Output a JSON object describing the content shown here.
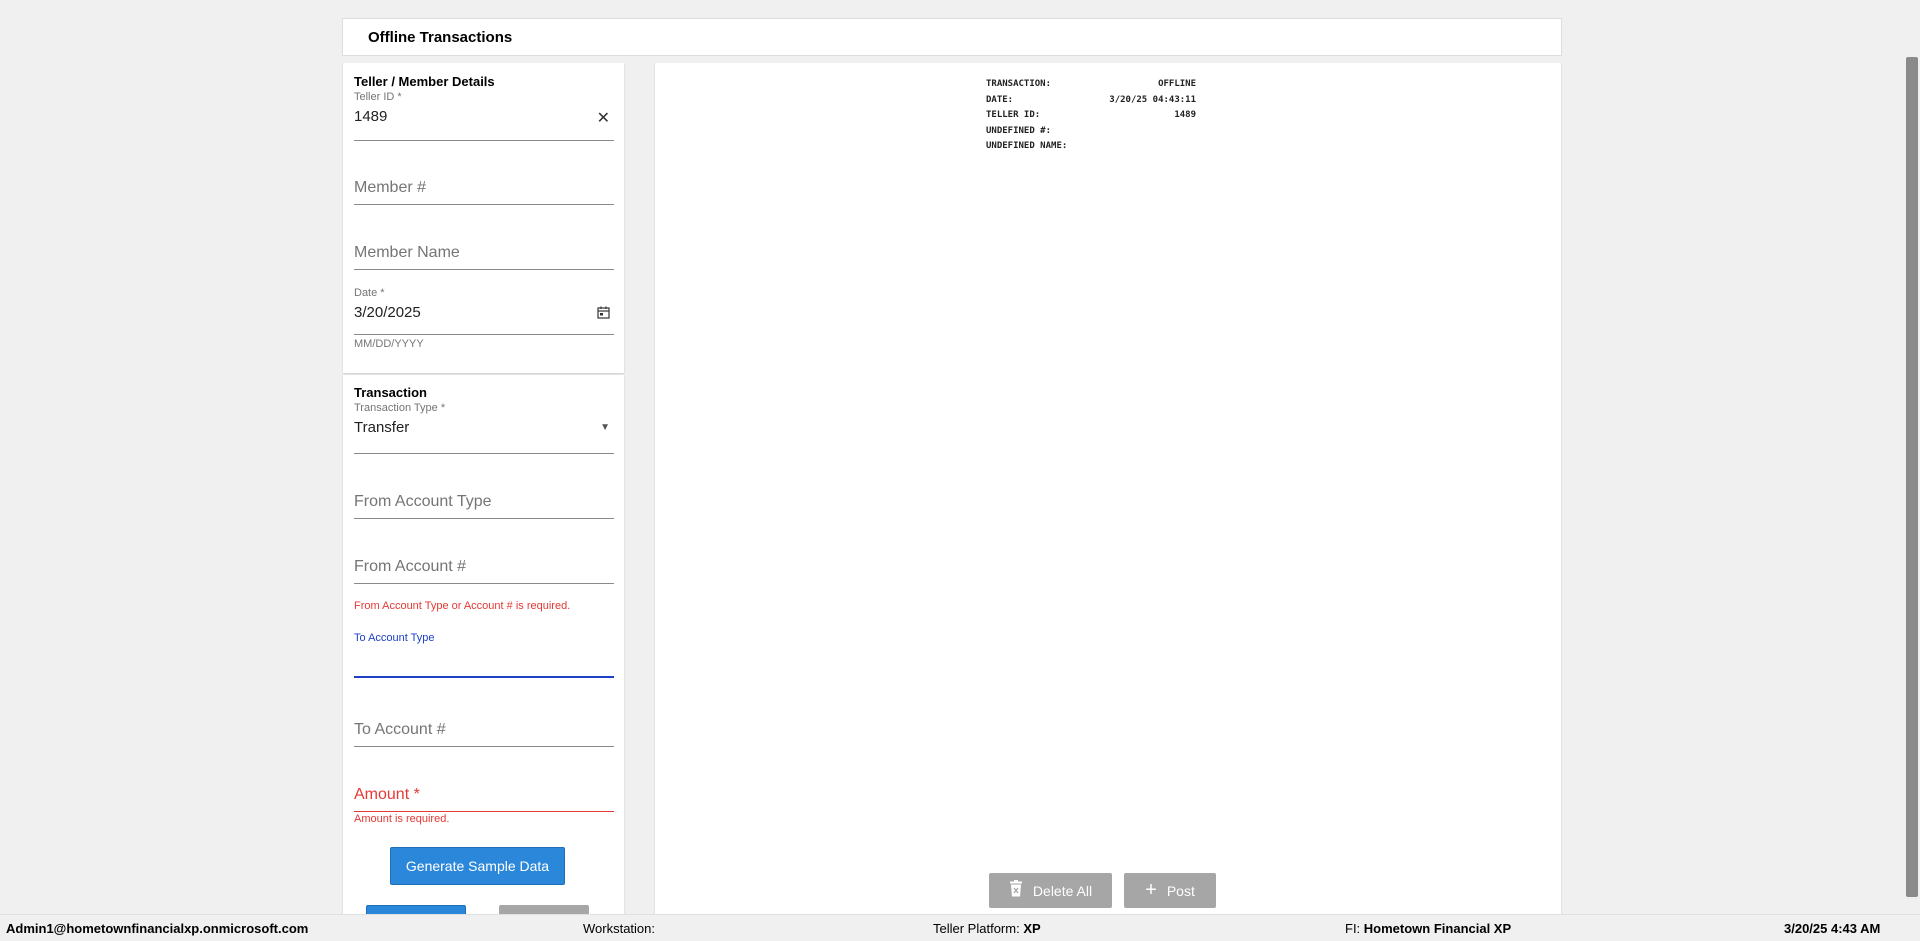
{
  "page": {
    "title": "Offline Transactions"
  },
  "teller_section": {
    "title": "Teller / Member Details",
    "teller_id_label": "Teller ID *",
    "teller_id_value": "1489",
    "member_number_placeholder": "Member #",
    "member_name_placeholder": "Member Name",
    "date_label": "Date *",
    "date_value": "3/20/2025",
    "date_helper": "MM/DD/YYYY"
  },
  "transaction_section": {
    "title": "Transaction",
    "type_label": "Transaction Type *",
    "type_value": "Transfer",
    "from_account_type_placeholder": "From Account Type",
    "from_account_number_placeholder": "From Account #",
    "from_error": "From Account Type or Account # is required.",
    "to_account_type_label": "To Account Type",
    "to_account_number_placeholder": "To Account #",
    "amount_placeholder": "Amount *",
    "amount_error": "Amount is required.",
    "generate_button": "Generate Sample Data"
  },
  "receipt": {
    "rows": [
      {
        "label": "TRANSACTION:",
        "value": "OFFLINE"
      },
      {
        "label": "DATE:",
        "value": "3/20/25 04:43:11"
      },
      {
        "label": "TELLER ID:",
        "value": "1489"
      },
      {
        "label": "UNDEFINED #:",
        "value": ""
      },
      {
        "label": "UNDEFINED NAME:",
        "value": ""
      }
    ]
  },
  "actions": {
    "delete_all": "Delete All",
    "post": "Post"
  },
  "status_bar": {
    "user": "Admin1@hometownfinancialxp.onmicrosoft.com",
    "workstation_label": "Workstation:",
    "workstation_value": "",
    "platform_label": "Teller Platform:",
    "platform_value": "XP",
    "fi_label": "FI:",
    "fi_value": "Hometown Financial XP",
    "datetime": "3/20/25 4:43 AM"
  },
  "colors": {
    "primary": "#2b87d9",
    "error": "#e53935",
    "focus": "#1e40c8",
    "disabled": "#a6a6a6"
  }
}
